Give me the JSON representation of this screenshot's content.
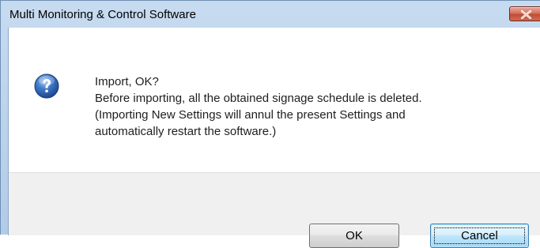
{
  "window": {
    "title": "Multi Monitoring & Control Software",
    "close_icon": "close-icon"
  },
  "dialog": {
    "icon": "question-icon",
    "message_lines": [
      "Import, OK?",
      "Before importing, all the obtained signage schedule is deleted.",
      "(Importing New Settings will annul the present Settings and",
      "automatically restart the software.)"
    ]
  },
  "buttons": {
    "ok_label": "OK",
    "cancel_label": "Cancel",
    "default_button": "cancel"
  },
  "colors": {
    "close_button": "#c7543c",
    "focused_button_border": "#3c7fb1",
    "footer_background": "#f0f0f0",
    "icon_blue": "#2b5fa8"
  }
}
